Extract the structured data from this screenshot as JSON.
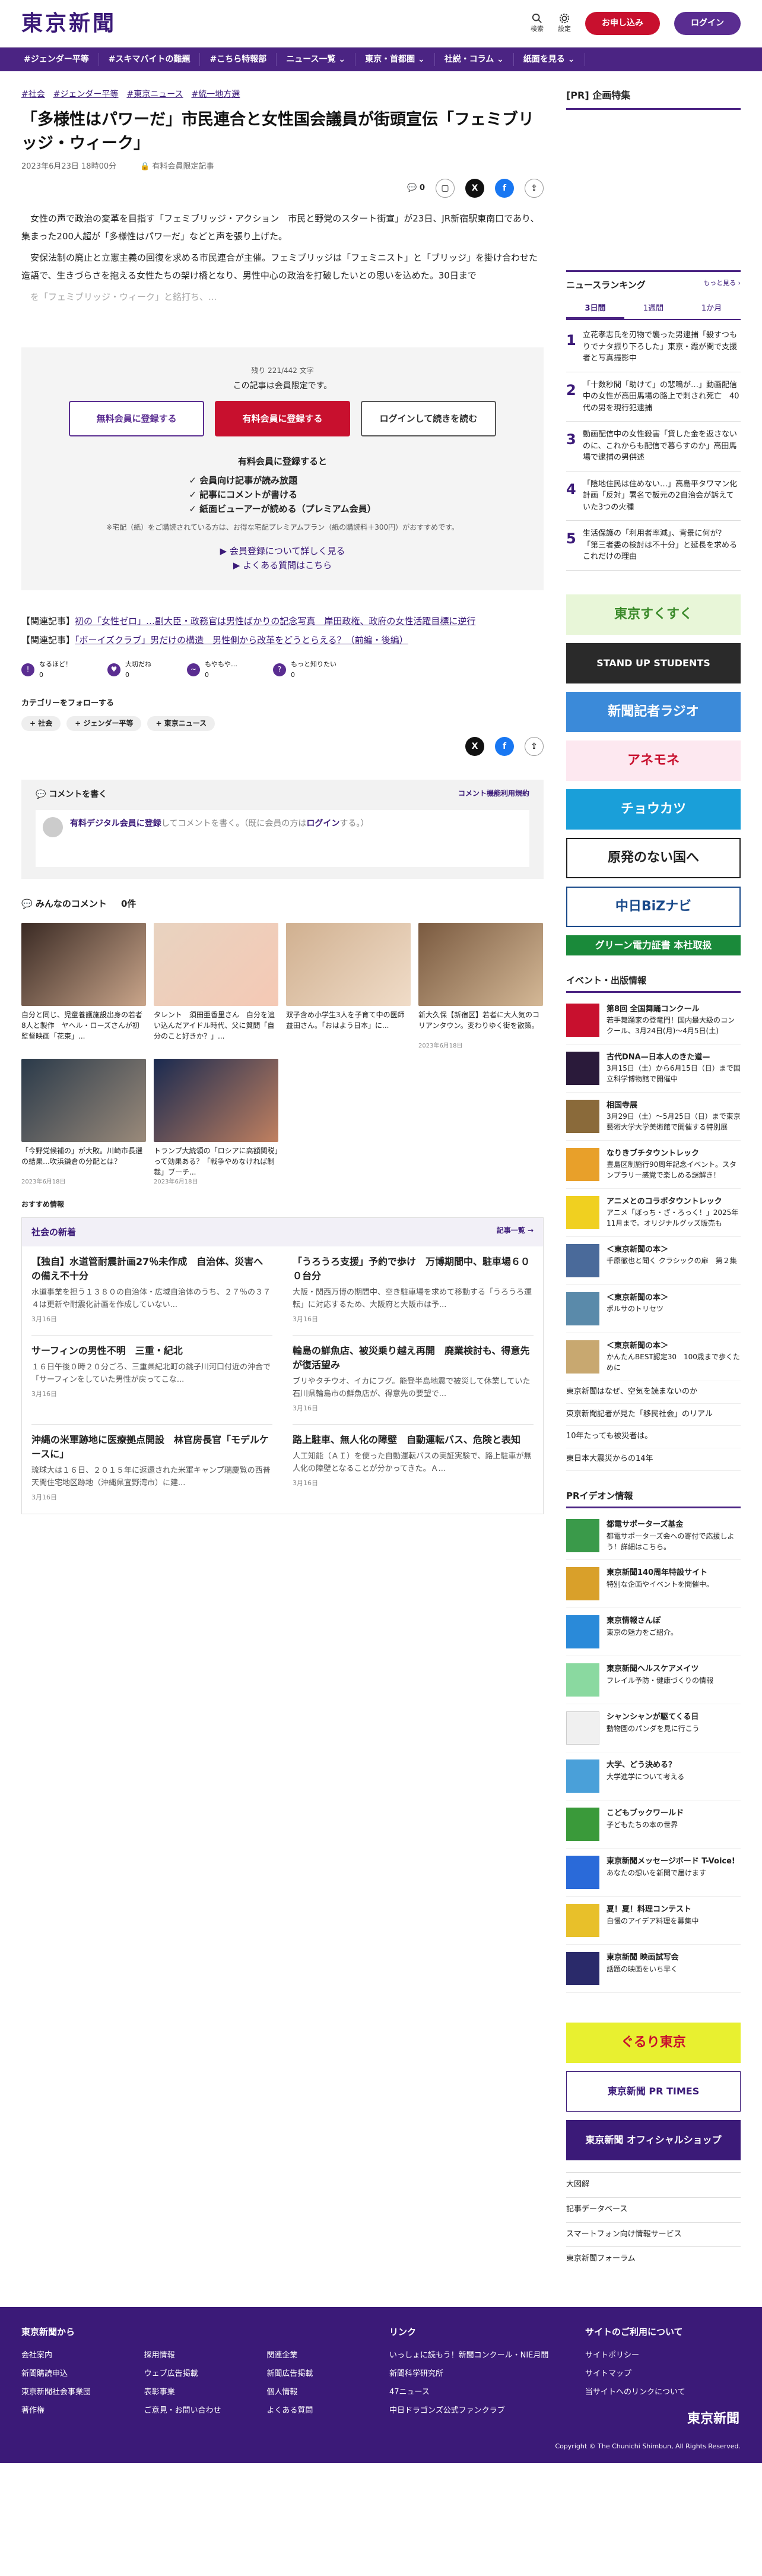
{
  "header": {
    "logo": "東京新聞",
    "search": "検索",
    "settings": "設定",
    "trial": "お申し込み",
    "login": "ログイン"
  },
  "nav": [
    "#ジェンダー平等",
    "#スキマバイトの難題",
    "#こちら特報部",
    "ニュース一覧 ⌄",
    "東京・首都圏 ⌄",
    "社説・コラム ⌄",
    "紙面を見る ⌄"
  ],
  "article": {
    "tags": [
      "#社会",
      "#ジェンダー平等",
      "#東京ニュース",
      "#統一地方選"
    ],
    "title": "「多様性はパワーだ」市民連合と女性国会議員が街頭宣伝「フェミブリッジ・ウィーク」",
    "date": "2023年6月23日 18時00分",
    "member": "有料会員限定記事",
    "comments": "0",
    "p1": "女性の声で政治の変革を目指す「フェミブリッジ・アクション　市民と野党のスタート街宣」が23日、JR新宿駅東南口であり、集まった200人超が「多様性はパワーだ」などと声を張り上げた。",
    "p2": "安保法制の廃止と立憲主義の回復を求める市民連合が主催。フェミブリッジは「フェミニスト」と「ブリッジ」を掛け合わせた造語で、生きづらさを抱える女性たちの架け橋となり、男性中心の政治を打破したいとの思いを込めた。30日まで",
    "p3": "を「フェミブリッジ・ウィーク」と銘打ち、..."
  },
  "paywall": {
    "remain": "残り 221/442 文字",
    "title": "この記事は会員限定です。",
    "b1": "無料会員に登録する",
    "b2": "有料会員に登録する",
    "b3": "ログインして続きを読む",
    "benefit": "有料会員に登録すると",
    "list": [
      "会員向け記事が読み放題",
      "記事にコメントが書ける",
      "紙面ビューアーが読める（プレミアム会員）"
    ],
    "note": "※宅配（紙）をご購読されている方は、お得な宅配プレミアムプラン（紙の購読料＋300円）がおすすめです。",
    "link1": "会員登録について詳しく見る",
    "link2": "よくある質問はこちら"
  },
  "related": [
    {
      "label": "【関連記事】",
      "text": "初の「女性ゼロ」…副大臣・政務官は男性ばかりの記念写真　岸田政権、政府の女性活躍目標に逆行"
    },
    {
      "label": "【関連記事】",
      "text": "「ボーイズクラブ」男だけの構造　男性側から改革をどうとらえる？（前編・後編）"
    }
  ],
  "reactions": [
    "なるほど！",
    "大切だね",
    "もやもや…",
    "もっと知りたい"
  ],
  "reaction_counts": [
    "0",
    "0",
    "0",
    "0"
  ],
  "follow": {
    "title": "カテゴリーをフォローする",
    "chips": [
      "+ 社会",
      "+ ジェンダー平等",
      "+ 東京ニュース"
    ]
  },
  "comment": {
    "title": "コメントを書く",
    "rules": "コメント機能利用規約",
    "prompt_a": "有料デジタル会員に登録",
    "prompt_b": "してコメントを書く。（既に会員の方は",
    "prompt_c": "ログイン",
    "prompt_d": "する。）"
  },
  "allcomments": {
    "title": "みんなのコメント",
    "count": "0件"
  },
  "photos": [
    {
      "cap": "自分と同じ、児童養護施設出身の若者8人と製作　ヤヘル・ローズさんが初監督映画「花束」...",
      "date": ""
    },
    {
      "cap": "タレント　須田亜香里さん　自分を追い込んだアイドル時代、父に質問「自分のこと好きか？」...",
      "date": ""
    },
    {
      "cap": "双子含め小学生3人を子育て中の医師 益田さん。「おはよう日本」に...",
      "date": ""
    },
    {
      "cap": "新大久保【新宿区】若者に大人気のコリアンタウン。変わりゆく街を散策。",
      "date": "2023年6月18日"
    },
    {
      "cap": "「今野党候補の」が大敗。川崎市長選の結果…吹浜鎌倉の分配とは？",
      "date": "2023年6月18日"
    },
    {
      "cap": "トランプ大統領の「ロシアに高額関税」って効果ある？「戦争やめなければ制裁」ブーチ...",
      "date": "2023年6月18日"
    }
  ],
  "recommend": "おすすめ情報",
  "news": {
    "title": "社会の新着",
    "more": "記事一覧 →",
    "items": [
      {
        "h": "【独自】水道管耐震計画27％未作成　自治体、災害への備え不十分",
        "p": "水道事業を担う１３８０の自治体・広域自治体のうち、２７％の３７４は更新や耐震化計画を作成していない...",
        "d": "3月16日"
      },
      {
        "h": "「うろうろ支援」予約で歩け　万博期間中、駐車場６００台分",
        "p": "大阪・関西万博の期間中、空き駐車場を求めて移動する「うろうろ運転」に対応するため、大阪府と大阪市は予...",
        "d": "3月16日"
      },
      {
        "h": "サーフィンの男性不明　三重・紀北",
        "p": "１６日午後０時２０分ごろ、三重県紀北町の銚子川河口付近の沖合で「サーフィンをしていた男性が戻ってこな...",
        "d": "3月16日"
      },
      {
        "h": "輪島の鮮魚店、被災乗り越え再開　廃業検討も、得意先が復活望み",
        "p": "ブリやタチウオ、イカにフグ。能登半島地震で被災して休業していた石川県輪島市の鮮魚店が、得意先の要望で...",
        "d": "3月16日"
      },
      {
        "h": "沖縄の米軍跡地に医療拠点開設　林官房長官「モデルケースに」",
        "p": "琉球大は１６日、２０１５年に返還された米軍キャンプ瑞慶覧の西普天間住宅地区跡地（沖縄県宜野湾市）に建...",
        "d": "3月16日"
      },
      {
        "h": "路上駐車、無人化の障壁　自動運転バス、危険と表知",
        "p": "人工知能（ＡＩ）を使った自動運転バスの実証実験で、路上駐車が無人化の障壁となることが分かってきた。Ａ...",
        "d": "3月16日"
      }
    ]
  },
  "side": {
    "pr": "[PR] 企画特集",
    "ranking": "ニュースランキング",
    "rank_more": "もっと見る ›",
    "tabs": [
      "3日間",
      "1週間",
      "1か月"
    ],
    "rank": [
      "立花孝志氏を刃物で襲った男逮捕「殺すつもりでナタ振り下ろした」東京・霞が関で支援者と写真撮影中",
      "「十数秒間「助けて」の悲鳴が…」動画配信中の女性が高田馬場の路上で刺され死亡　40代の男を現行犯逮捕",
      "動画配信中の女性殺害「貸した金を返さないのに、これからも配信で暮らすのか」高田馬場で逮捕の男供述",
      "「陰地住民は住めない…」高島平タワマン化計画「反対」署名で板元の2自治会が訴えていた3つの火種",
      "生活保護の「利用者率減」、背景に何が？「第三者委の検討は不十分」と延長を求めるこれだけの理由"
    ],
    "banners": [
      "東京すくすく",
      "STAND UP STUDENTS",
      "新聞記者ラジオ",
      "アネモネ",
      "チョウカツ",
      "原発のない国へ",
      "中日BiZナビ",
      "グリーン電力証書 本社取扱"
    ],
    "events_title": "イベント・出版情報",
    "events": [
      {
        "t": "第8回 全国舞踊コンクール",
        "s": "若手舞踊家の登竜門！国内最大級のコンクール、3月24日(月)〜4月5日(土)"
      },
      {
        "t": "古代DNA—日本人のきた道—",
        "s": "3月15日（土）から6月15日（日）まで国立科学博物館で開催中"
      },
      {
        "t": "相国寺展",
        "s": "3月29日（土）〜5月25日（日）まで東京藝術大学大学美術館で開催する特別展"
      },
      {
        "t": "なりきブチタウントレック",
        "s": "豊島区制施行90周年記念イベント。スタンプラリー感覚で楽しめる謎解き！"
      },
      {
        "t": "アニメとのコラボタウントレック",
        "s": "アニメ「ぼっち・ざ・ろっく！」2025年11月まで。オリジナルグッズ販売も"
      },
      {
        "t": "＜東京新聞の本＞",
        "s": "千原徹也と聞く クラシックの扉　第２集"
      },
      {
        "t": "＜東京新聞の本＞",
        "s": "ポルサのトリセツ"
      },
      {
        "t": "＜東京新聞の本＞",
        "s": "かんたんBEST認定30　100歳まで歩くために"
      }
    ],
    "books": [
      "東京新聞はなぜ、空気を読まないのか",
      "東京新聞記者が見た「移民社会」のリアル",
      "10年たっても被災者は。",
      "東日本大震災からの14年"
    ],
    "pri": "PRイデオン情報",
    "pri_items": [
      {
        "t": "都電サポーターズ基金",
        "s": "都電サポーターズ会への寄付で応援しよう！詳細はこちら。"
      },
      {
        "t": "東京新聞140周年特設サイト",
        "s": "特別な企画やイベントを開催中。"
      },
      {
        "t": "東京情報さんぽ",
        "s": "東京の魅力をご紹介。"
      },
      {
        "t": "東京新聞ヘルスケアメイツ",
        "s": "フレイル予防・健康づくりの情報"
      },
      {
        "t": "シャンシャンが駆てくる日",
        "s": "動物園のパンダを見に行こう"
      },
      {
        "t": "大学、どう決める？",
        "s": "大学進学について考える"
      },
      {
        "t": "こどもブックワールド",
        "s": "子どもたちの本の世界"
      },
      {
        "t": "東京新聞メッセージボード T-Voice!",
        "s": "あなたの想いを新聞で届けます"
      },
      {
        "t": "夏！夏！料理コンテスト",
        "s": "自慢のアイデア料理を募集中"
      },
      {
        "t": "東京新聞 映画試写会",
        "s": "話題の映画をいち早く"
      }
    ],
    "banners2": [
      "ぐるり東京",
      "東京新聞 PR TIMES",
      "東京新聞 オフィシャルショップ"
    ],
    "links": [
      "大図解",
      "記事データベース",
      "スマートフォン向け情報サービス",
      "東京新聞フォーラム"
    ]
  },
  "footer": {
    "col1": "東京新聞から",
    "col1_items": [
      "会社案内",
      "採用情報",
      "関連企業",
      "新聞購読申込",
      "ウェブ広告掲載",
      "新聞広告掲載",
      "東京新聞社会事業団",
      "表彰事業",
      "個人情報",
      "著作権",
      "ご意見・お問い合わせ",
      "よくある質問"
    ],
    "col2": "リンク",
    "col2_items": [
      "いっしょに読もう！新聞コンクール・NIE月間",
      "新聞科学研究所",
      "47ニュース",
      "中日ドラゴンズ公式ファンクラブ"
    ],
    "col3": "サイトのご利用について",
    "col3_items": [
      "サイトポリシー",
      "サイトマップ",
      "当サイトへのリンクについて"
    ],
    "copyright": "Copyright © The Chunichi Shimbun, All Rights Reserved."
  }
}
